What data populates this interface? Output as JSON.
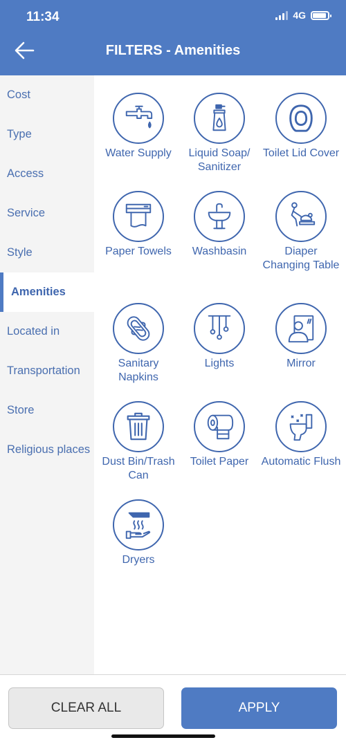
{
  "status": {
    "time": "11:34",
    "network": "4G"
  },
  "header": {
    "title": "FILTERS - Amenities"
  },
  "colors": {
    "primary": "#4f7bc3",
    "icon_blue": "#3f66ae",
    "sidebar_bg": "#f4f4f4"
  },
  "sidebar": {
    "items": [
      {
        "label": "Cost"
      },
      {
        "label": "Type"
      },
      {
        "label": "Access"
      },
      {
        "label": "Service"
      },
      {
        "label": "Style"
      },
      {
        "label": "Amenities",
        "active": true
      },
      {
        "label": "Located in"
      },
      {
        "label": "Transportation"
      },
      {
        "label": "Store"
      },
      {
        "label": "Religious places"
      }
    ]
  },
  "amenities": [
    {
      "label": "Water Supply",
      "icon": "faucet-icon"
    },
    {
      "label": "Liquid Soap/ Sanitizer",
      "icon": "soap-dispenser-icon"
    },
    {
      "label": "Toilet Lid Cover",
      "icon": "toilet-seat-icon"
    },
    {
      "label": "Paper Towels",
      "icon": "paper-towel-icon"
    },
    {
      "label": "Washbasin",
      "icon": "washbasin-icon"
    },
    {
      "label": "Diaper Changing Table",
      "icon": "baby-changing-icon"
    },
    {
      "label": "Sanitary Napkins",
      "icon": "sanitary-pad-icon"
    },
    {
      "label": "Lights",
      "icon": "light-bulbs-icon"
    },
    {
      "label": "Mirror",
      "icon": "mirror-icon"
    },
    {
      "label": "Dust Bin/Trash Can",
      "icon": "trash-bin-icon"
    },
    {
      "label": "Toilet Paper",
      "icon": "toilet-paper-icon"
    },
    {
      "label": "Automatic Flush",
      "icon": "auto-flush-icon"
    },
    {
      "label": "Dryers",
      "icon": "hand-dryer-icon"
    }
  ],
  "footer": {
    "clear_label": "CLEAR ALL",
    "apply_label": "APPLY"
  }
}
